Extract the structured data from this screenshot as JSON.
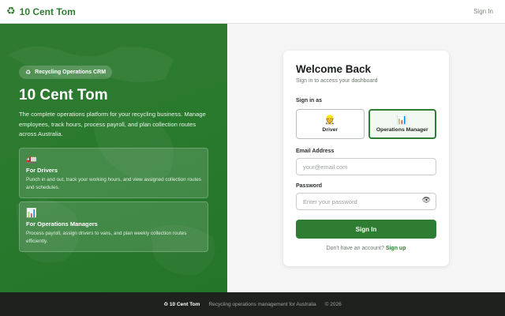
{
  "header": {
    "brand_icon": "♻",
    "brand_name": "10 Cent Tom",
    "signin_link": "Sign In"
  },
  "hero": {
    "badge_icon": "♻",
    "badge": "Recycling Operations CRM",
    "title": "10 Cent Tom",
    "description": "The complete operations platform for your recycling business. Manage employees, track hours, process payroll, and plan collection routes across Australia.",
    "features": [
      {
        "icon": "🚛",
        "icon_name": "truck-icon",
        "title": "For Drivers",
        "description": "Punch in and out, track your working hours, and view assigned collection routes and schedules."
      },
      {
        "icon": "📊",
        "icon_name": "bar-chart-icon",
        "title": "For Operations Managers",
        "description": "Process payroll, assign drivers to vans, and plan weekly collection routes efficiently."
      }
    ]
  },
  "login": {
    "title": "Welcome Back",
    "subtitle": "Sign in to access your dashboard",
    "role_label": "Sign in as",
    "roles": [
      {
        "icon": "👷",
        "icon_name": "driver-icon",
        "label": "Driver",
        "selected": false
      },
      {
        "icon": "📊",
        "icon_name": "bar-chart-icon",
        "label": "Operations Manager",
        "selected": true
      }
    ],
    "email_label": "Email Address",
    "email_placeholder": "your@email.com",
    "email_value": "",
    "password_label": "Password",
    "password_placeholder": "Enter your password",
    "password_value": "",
    "show_password_icon": "👁",
    "submit_label": "Sign In",
    "signup_prompt": "Don't have an account?",
    "signup_link": "Sign up"
  },
  "footer": {
    "brand_icon": "♻",
    "brand": "10 Cent Tom",
    "tagline": "Recycling operations management for Australia",
    "copyright": "© 2026"
  },
  "colors": {
    "primary": "#2e7d32",
    "hero_bg": "#2a7a2e",
    "footer_bg": "#1f211f"
  }
}
